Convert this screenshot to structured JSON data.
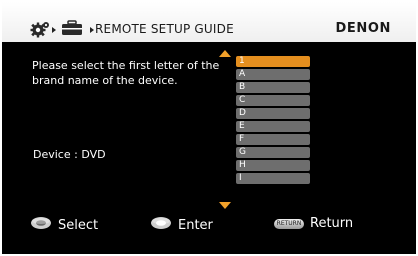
{
  "header": {
    "title": "REMOTE SETUP GUIDE",
    "brand": "DENON"
  },
  "instruction": "Please select the first letter of the brand name of the device.",
  "device": {
    "label": "Device : DVD"
  },
  "letters": {
    "selected_index": 0,
    "items": [
      "1",
      "A",
      "B",
      "C",
      "D",
      "E",
      "F",
      "G",
      "H",
      "I"
    ]
  },
  "footer": {
    "select_label": "Select",
    "enter_label": "Enter",
    "return_button_text": "RETURN",
    "return_label": "Return"
  },
  "colors": {
    "accent": "#e58f1f",
    "item_bg": "#6e6e6e",
    "screen_bg": "#000000"
  }
}
